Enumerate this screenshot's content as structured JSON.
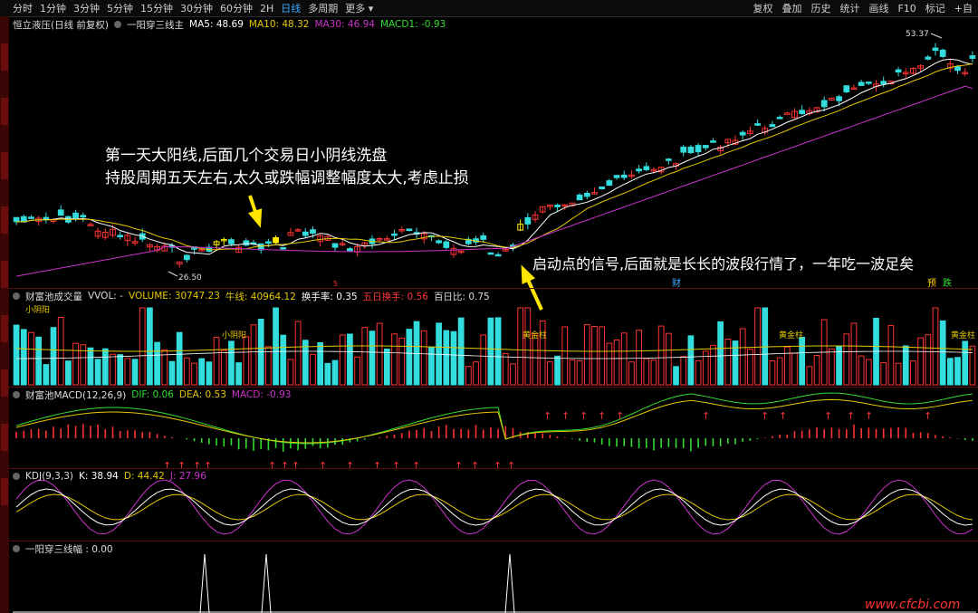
{
  "toolbar": {
    "periods": [
      "分时",
      "1分钟",
      "3分钟",
      "5分钟",
      "15分钟",
      "30分钟",
      "60分钟",
      "2H",
      "日线",
      "多周期",
      "更多"
    ],
    "active_period": "日线",
    "right_buttons": [
      "复权",
      "叠加",
      "历史",
      "统计",
      "画线",
      "F10",
      "标记",
      "+自"
    ]
  },
  "main_panel": {
    "stock_name": "恒立液压(日线 前复权)",
    "indicator_name": "一阳穿三线主",
    "ma5": "MA5: 48.69",
    "ma10": "MA10: 48.32",
    "ma30": "MA30: 46.94",
    "macd1": "MACD1: -0.93",
    "high_label": "53.37",
    "low_label": "26.50",
    "marker_cai": "财",
    "marker_yu": "预",
    "marker_die": "跌",
    "marker_num": "5"
  },
  "annotations": {
    "line1": "第一天大阳线,后面几个交易日小阴线洗盘",
    "line2": "持股周期五天左右,太久或跌幅调整幅度太大,考虑止损",
    "line3": "启动点的信号,后面就是长长的波段行情了，一年吃一波足矣"
  },
  "volume_panel": {
    "title": "财富池成交量",
    "vvol": "VVOL: -",
    "volume": "VOLUME: 30747.23",
    "niuxian": "牛线: 40964.12",
    "huanshou": "换手率: 0.35",
    "wuri": "五日换手: 0.56",
    "bairibi": "百日比: 0.75",
    "labels": [
      "小阴阳",
      "小阴阳",
      "黄金柱",
      "黄金柱",
      "黄金柱"
    ]
  },
  "macd_panel": {
    "title": "财富池MACD(12,26,9)",
    "dif": "DIF: 0.06",
    "dea": "DEA: 0.53",
    "macd": "MACD: -0.93"
  },
  "kdj_panel": {
    "title": "KDJ(9,3,3)",
    "k": "K: 38.94",
    "d": "D: 44.42",
    "j": "J: 27.96"
  },
  "signal_panel": {
    "title": "一阳穿三线幅 : 0.00"
  },
  "watermark": "www.cfcbi.com",
  "colors": {
    "up": "#ff3333",
    "down": "#33dddd",
    "ma5": "#ffffff",
    "ma10": "#e5c800",
    "ma30": "#cc33cc",
    "gold": "#ffee00",
    "accent": "#3fa9ff"
  }
}
